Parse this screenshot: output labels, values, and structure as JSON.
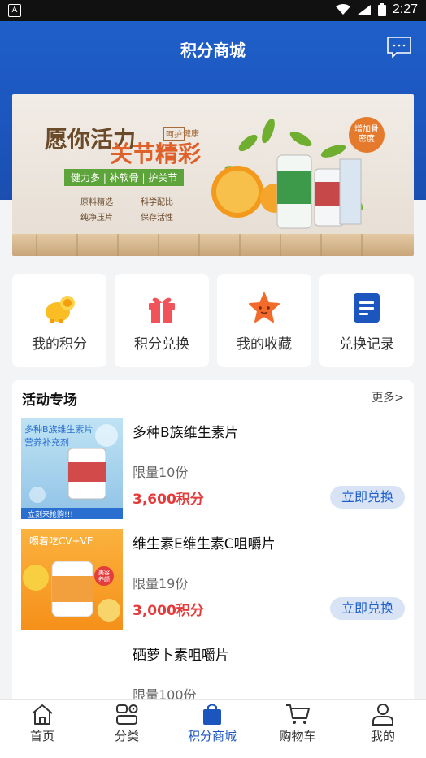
{
  "status": {
    "left_icon": "A",
    "time": "2:27"
  },
  "header": {
    "title": "积分商城"
  },
  "banner": {
    "headline": "愿你活力",
    "headline2": "关节精彩",
    "tag1": "呵护",
    "tag2": "健康",
    "badge": "增加骨密度",
    "slogan": "健力多 | 补软骨 | 护关节",
    "features": [
      "原料精选",
      "科学配比",
      "纯净压片",
      "保存活性"
    ]
  },
  "quick": [
    {
      "label": "我的积分",
      "icon": "coin-pig-icon"
    },
    {
      "label": "积分兑换",
      "icon": "gift-icon"
    },
    {
      "label": "我的收藏",
      "icon": "star-icon"
    },
    {
      "label": "兑换记录",
      "icon": "document-icon"
    }
  ],
  "activity": {
    "title": "活动专场",
    "more": "更多>",
    "products": [
      {
        "name": "多种B族维生素片",
        "limit": "限量10份",
        "price": "3,600积分",
        "button": "立即兑换",
        "img_text1": "多种B族维生素片",
        "img_text2": "营养补充剂",
        "img_text3": "立刻来抢购!!!"
      },
      {
        "name": "维生素E维生素C咀嚼片",
        "limit": "限量19份",
        "price": "3,000积分",
        "button": "立即兑换",
        "img_text1": "嚼着吃CV+VE",
        "img_text2": "美容养颜"
      },
      {
        "name": "硒萝卜素咀嚼片",
        "limit": "限量100份",
        "price": "",
        "button": ""
      }
    ]
  },
  "tabs": [
    {
      "label": "首页",
      "icon": "home-icon"
    },
    {
      "label": "分类",
      "icon": "category-icon"
    },
    {
      "label": "积分商城",
      "icon": "shopping-bag-icon"
    },
    {
      "label": "购物车",
      "icon": "cart-icon"
    },
    {
      "label": "我的",
      "icon": "user-icon"
    }
  ],
  "colors": {
    "primary": "#1c55bd",
    "price": "#e63a3a",
    "button_bg": "#d8e4f6"
  }
}
